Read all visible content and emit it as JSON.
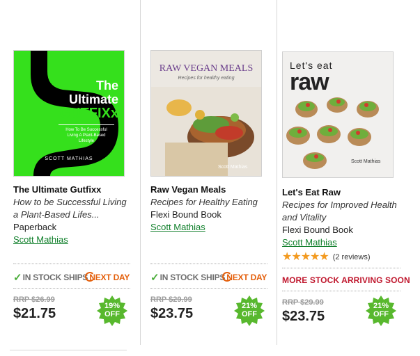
{
  "products": [
    {
      "title": "The Ultimate Gutfixx",
      "subtitle": "How to be Successful Living a Plant-Based Lifes...",
      "format": "Paperback",
      "author": "Scott Mathias",
      "stock": {
        "in_stock": "IN STOCK SHIPS",
        "next_day": "NEXT DAY"
      },
      "rrp": "RRP $26.99",
      "price": "$21.75",
      "discount": {
        "pct": "19%",
        "off": "OFF"
      },
      "cover": {
        "line1": "The",
        "line2": "Ultimate",
        "line3": "GUTFIXx",
        "tagline1": "How To Be Successful",
        "tagline2": "Living A Plant-Based",
        "tagline3": "Lifestyle",
        "author": "SCOTT MATHIAS",
        "bg": "#35e01c"
      }
    },
    {
      "title": "Raw Vegan Meals",
      "subtitle": "Recipes for Healthy Eating",
      "format": "Flexi Bound Book",
      "author": "Scott Mathias",
      "stock": {
        "in_stock": "IN STOCK SHIPS",
        "next_day": "NEXT DAY"
      },
      "rrp": "RRP $29.99",
      "price": "$23.75",
      "discount": {
        "pct": "21%",
        "off": "OFF"
      },
      "cover": {
        "title": "RAW VEGAN MEALS",
        "sub": "Recipes for healthy eating",
        "author": "Scott Mathias"
      }
    },
    {
      "title": "Let's Eat Raw",
      "subtitle": "Recipes for Improved Health and Vitality",
      "format": "Flexi Bound Book",
      "author": "Scott Mathias",
      "rating": 5,
      "reviews": "(2 reviews)",
      "more_stock": "MORE STOCK ARRIVING SOON",
      "rrp": "RRP $29.99",
      "price": "$23.75",
      "discount": {
        "pct": "21%",
        "off": "OFF"
      },
      "cover": {
        "line1": "Let's eat",
        "line2": "raw",
        "author": "Scott Mathias"
      }
    }
  ],
  "colors": {
    "accent_green": "#11802c",
    "badge_green": "#58b82e",
    "next_day_orange": "#e45f0b",
    "alert_red": "#c0182e"
  }
}
